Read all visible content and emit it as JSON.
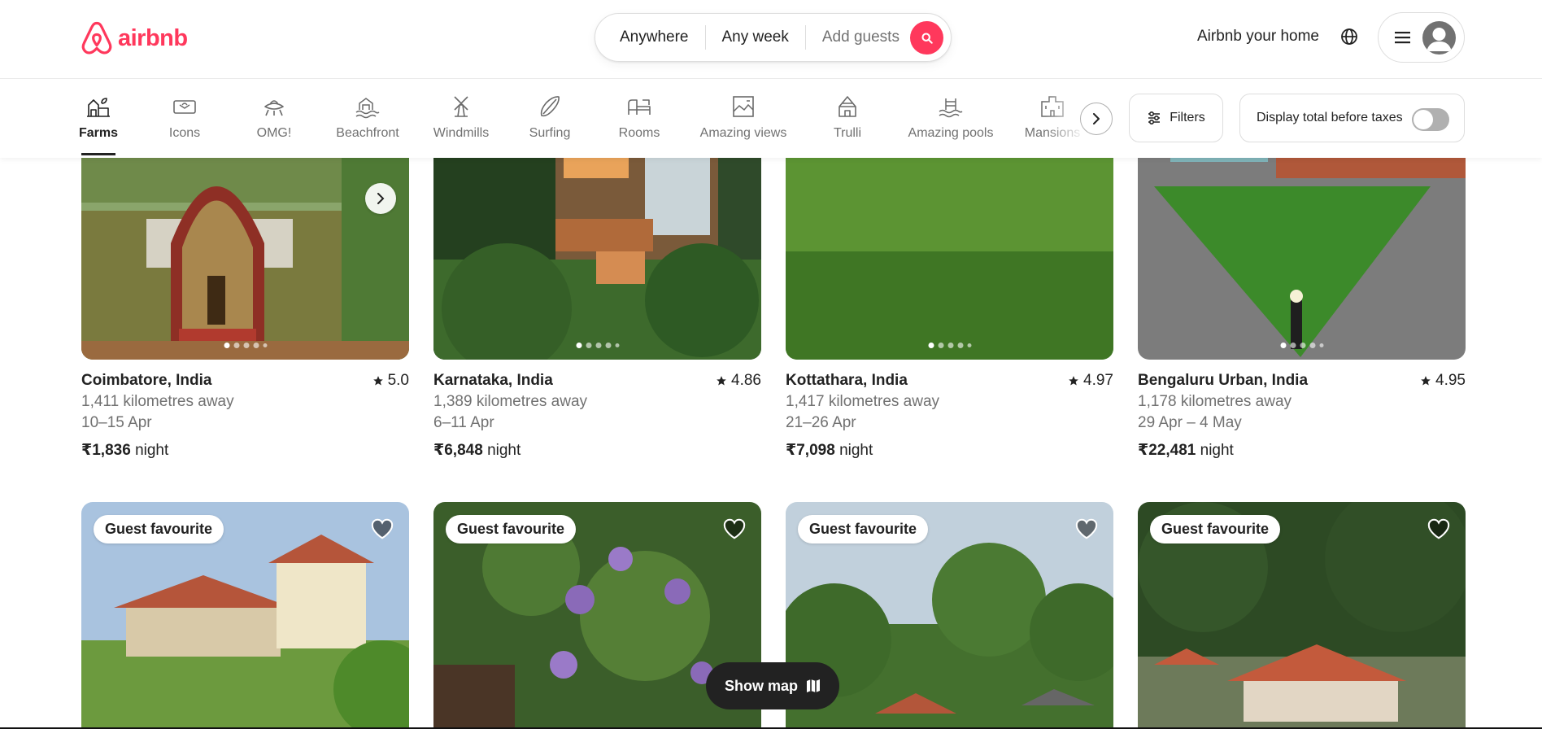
{
  "header": {
    "brand": "airbnb",
    "search": {
      "where": "Anywhere",
      "when": "Any week",
      "who": "Add guests"
    },
    "host_link": "Airbnb your home",
    "globe_icon": "globe-icon",
    "menu_icon": "hamburger-icon",
    "avatar_icon": "user-avatar-icon"
  },
  "categories": [
    {
      "label": "Farms",
      "icon": "farm-icon",
      "active": true
    },
    {
      "label": "Icons",
      "icon": "icons-ufo-icon",
      "active": false
    },
    {
      "label": "OMG!",
      "icon": "omg-icon",
      "active": false
    },
    {
      "label": "Beachfront",
      "icon": "beachfront-icon",
      "active": false
    },
    {
      "label": "Windmills",
      "icon": "windmill-icon",
      "active": false
    },
    {
      "label": "Surfing",
      "icon": "surfboard-icon",
      "active": false
    },
    {
      "label": "Rooms",
      "icon": "rooms-icon",
      "active": false
    },
    {
      "label": "Amazing views",
      "icon": "amazing-views-icon",
      "active": false
    },
    {
      "label": "Trulli",
      "icon": "trulli-icon",
      "active": false
    },
    {
      "label": "Amazing pools",
      "icon": "pool-icon",
      "active": false
    },
    {
      "label": "Mansions",
      "icon": "mansion-icon",
      "active": false
    }
  ],
  "filters": {
    "label": "Filters",
    "taxes_label": "Display total before taxes",
    "taxes_on": false
  },
  "listings": [
    {
      "location": "Coimbatore, India",
      "rating": "5.0",
      "distance": "1,411 kilometres away",
      "dates": "10–15 Apr",
      "price": "₹1,836",
      "price_unit": "night"
    },
    {
      "location": "Karnataka, India",
      "rating": "4.86",
      "distance": "1,389 kilometres away",
      "dates": "6–11 Apr",
      "price": "₹6,848",
      "price_unit": "night"
    },
    {
      "location": "Kottathara, India",
      "rating": "4.97",
      "distance": "1,417 kilometres away",
      "dates": "21–26 Apr",
      "price": "₹7,098",
      "price_unit": "night"
    },
    {
      "location": "Bengaluru Urban, India",
      "rating": "4.95",
      "distance": "1,178 kilometres away",
      "dates": "29 Apr – 4 May",
      "price": "₹22,481",
      "price_unit": "night"
    }
  ],
  "second_row": [
    {
      "badge": "Guest favourite"
    },
    {
      "badge": "Guest favourite"
    },
    {
      "badge": "Guest favourite"
    },
    {
      "badge": "Guest favourite"
    }
  ],
  "show_map": {
    "label": "Show map",
    "icon": "map-icon"
  },
  "colors": {
    "brand": "#ff385c",
    "text": "#222222",
    "muted": "#717171",
    "border": "#dddddd"
  }
}
